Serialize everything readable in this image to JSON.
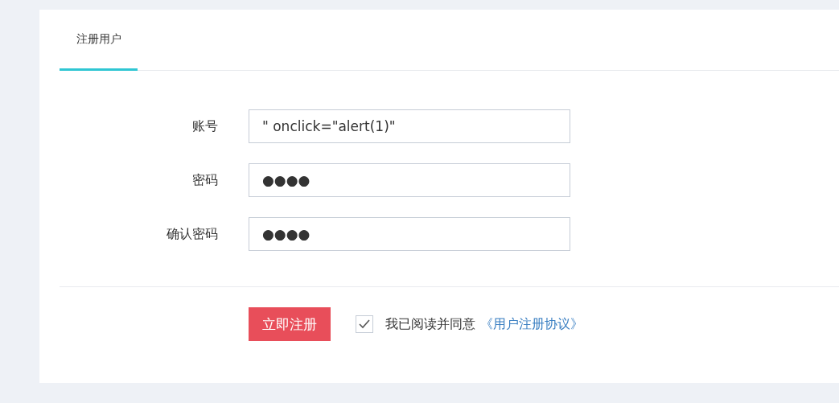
{
  "tabs": [
    {
      "label": "注册用户",
      "selected": true
    }
  ],
  "fields": [
    {
      "label": "账号",
      "value": "\" onclick=\"alert(1)\""
    },
    {
      "label": "密码",
      "value": "●●●●"
    },
    {
      "label": "确认密码",
      "value": "●●●●"
    }
  ],
  "submit": "立即注册",
  "agreement": {
    "checked": true,
    "text": "我已阅读并同意",
    "link": "《用户注册协议》"
  }
}
